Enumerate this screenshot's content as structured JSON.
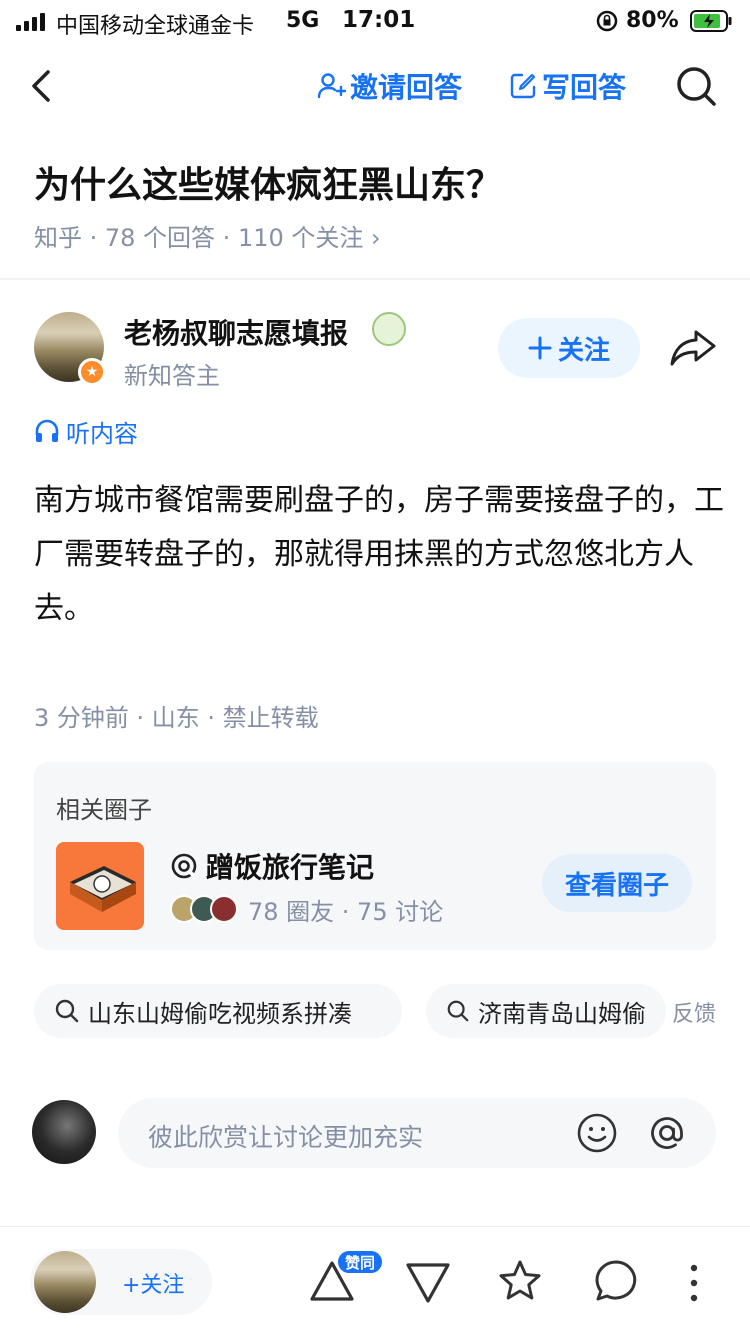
{
  "status": {
    "carrier": "中国移动全球通金卡",
    "network": "5G",
    "time": "17:01",
    "battery": "80%"
  },
  "nav": {
    "invite_label": "邀请回答",
    "write_label": "写回答"
  },
  "question": {
    "title": "为什么这些媒体疯狂黑山东？",
    "meta": "知乎 · 78 个回答 · 110 个关注 ›"
  },
  "author": {
    "name": "老杨叔聊志愿填报",
    "subtitle": "新知答主",
    "follow_label": "关注"
  },
  "listen_label": "听内容",
  "answer": {
    "content": "南方城市餐馆需要刷盘子的，房子需要接盘子的，工厂需要转盘子的，那就得用抹黑的方式忽悠北方人去。",
    "meta": "3 分钟前 · 山东 · 禁止转载"
  },
  "circle": {
    "section_label": "相关圈子",
    "name": "蹭饭旅行笔记",
    "stats": "78 圈友 · 75 讨论",
    "view_label": "查看圈子"
  },
  "searches": {
    "items": [
      "山东山姆偷吃视频系拼凑",
      "济南青岛山姆偷"
    ],
    "feedback_label": "反馈"
  },
  "comment": {
    "placeholder": "彼此欣赏让讨论更加充实"
  },
  "bottom": {
    "follow_label": "+关注",
    "upvote_badge": "赞同"
  },
  "colors": {
    "accent": "#1772f6",
    "muted": "#8590a6"
  }
}
